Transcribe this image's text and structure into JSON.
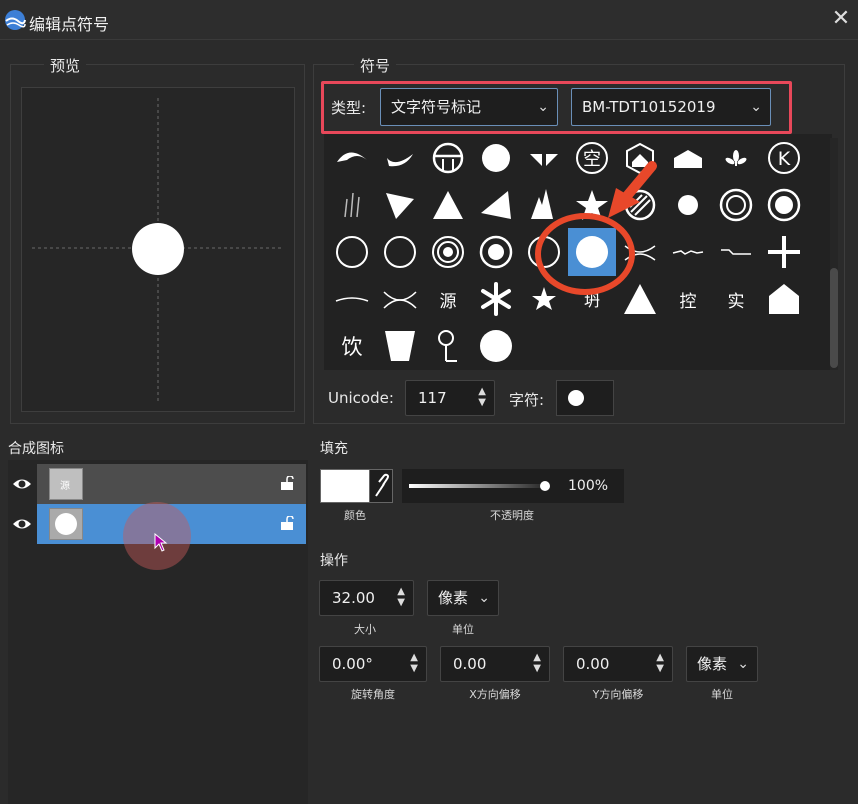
{
  "window": {
    "title": "编辑点符号",
    "close_glyph": "✕"
  },
  "preview": {
    "group_title": "预览"
  },
  "symbol": {
    "group_title": "符号",
    "type_label": "类型:",
    "type_value": "文字符号标记",
    "font_value": "BM-TDT10152019",
    "grid_text": {
      "kong_char": "空",
      "k_char": "K",
      "yuan": "源",
      "kong2": "控",
      "shi": "实",
      "yin": "饮",
      "shu": "坍"
    },
    "unicode_label": "Unicode:",
    "unicode_value": "117",
    "char_label": "字符:"
  },
  "layers": {
    "title": "合成图标",
    "thumb1_text": "源"
  },
  "fill": {
    "title": "填充",
    "color_label": "颜色",
    "opacity_label": "不透明度",
    "opacity_value": "100%",
    "opacity_fraction": 1.0,
    "color": "#ffffff"
  },
  "ops": {
    "title": "操作",
    "size_value": "32.00",
    "size_label": "大小",
    "unit1_value": "像素",
    "unit1_label": "单位",
    "rotation_value": "0.00°",
    "rotation_label": "旋转角度",
    "xoffset_value": "0.00",
    "xoffset_label": "X方向偏移",
    "yoffset_value": "0.00",
    "yoffset_label": "Y方向偏移",
    "unit2_value": "像素",
    "unit2_label": "单位"
  },
  "colors": {
    "accent": "#4a8fd4",
    "annotation": "#e8482a",
    "selected_layer": "#4a8fd4"
  }
}
